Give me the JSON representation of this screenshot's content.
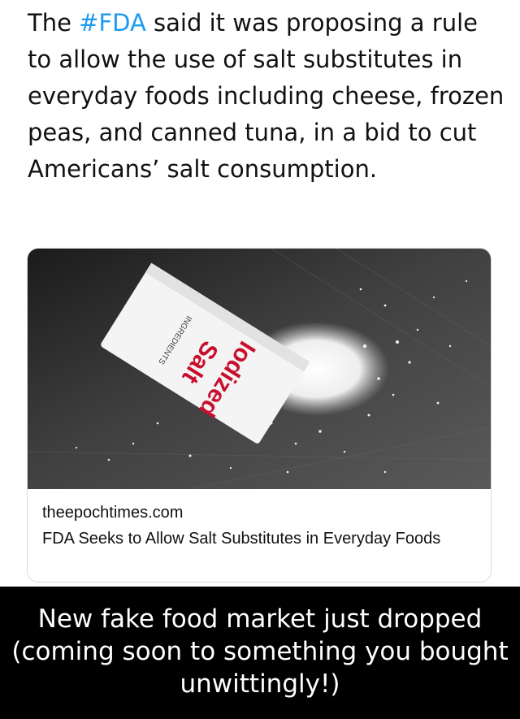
{
  "tweet": {
    "text_before": "The ",
    "hashtag": "#FDA",
    "text_after": " said it was proposing a rule to allow the use of salt substitutes in everyday foods including cheese, frozen peas, and canned tuna, in a bid to cut Americans’ salt consumption.",
    "hashtag_color": "#1d9bf0"
  },
  "card": {
    "domain": "theepochtimes.com",
    "title": "FDA Seeks to Allow Salt Substitutes in Everyday Foods",
    "image": {
      "packet_brand": "Iodized",
      "packet_product": "Salt",
      "packet_ingredients": "INGREDIENTS"
    }
  },
  "caption": {
    "text": "New fake food market just dropped (coming soon to something you bought unwittingly!)"
  }
}
